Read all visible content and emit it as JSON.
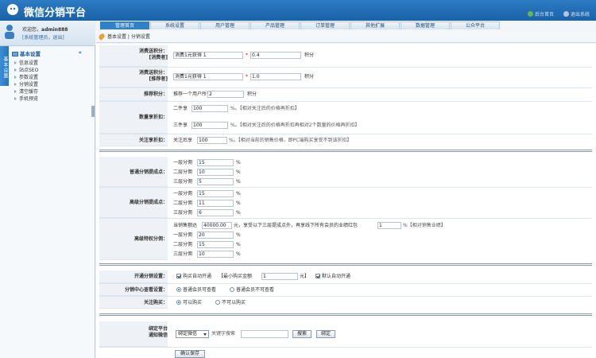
{
  "header": {
    "app_title": "微信分销平台",
    "links": [
      "后台首页",
      "退出系统"
    ]
  },
  "user": {
    "greeting": "欢迎您，",
    "username": "admin888",
    "role": "[系统管理员，退出]"
  },
  "nav": {
    "tabs": [
      "管理首页",
      "系统设置",
      "用户管理",
      "产品管理",
      "订单管理",
      "其他扩展",
      "数据管理",
      "公众平台"
    ],
    "active": "管理首页"
  },
  "breadcrumb": "基本设置 | 分销设置",
  "sidebar": {
    "vertical_tab": "基本设置",
    "section": "基本设置",
    "collapse": "«",
    "items": [
      "信息设置",
      "站点SEO",
      "参数设置",
      "分销设置",
      "清空缓存",
      "手机预览"
    ]
  },
  "form": {
    "consume_buyer": {
      "label1": "消费送积分：",
      "label2": "[消费者]",
      "value": "消费1元获得 1",
      "mult": "0.4",
      "unit": "积分"
    },
    "consume_referrer": {
      "label1": "消费送积分：",
      "label2": "[推荐者]",
      "value": "消费1元获得 1",
      "mult": "1.0",
      "unit": "积分"
    },
    "referral_points": {
      "label": "推荐积分：",
      "prefix": "推荐一个用户所得",
      "value": "2",
      "unit": "积分"
    },
    "qty_discount": {
      "label": "数量享折扣：",
      "r1_prefix": "二件享",
      "r1_value": "100",
      "r1_hint": "%。【相对关注后的价格再折扣】",
      "r2_prefix": "三件享",
      "r2_value": "100",
      "r2_hint": "%。【相对关注后的价格再折扣再相对2个数量的价格再折扣】"
    },
    "follow_discount": {
      "label": "关注享折扣：",
      "prefix": "关注后享",
      "value": "100",
      "hint": "%。【相对当前的销售价格，即PC端购买享受不到该折扣】"
    },
    "normal_points": {
      "label": "普通分销提成点：",
      "rows": [
        {
          "prefix": "一层分佣",
          "value": "15",
          "unit": "%"
        },
        {
          "prefix": "二层分佣",
          "value": "10",
          "unit": "%"
        },
        {
          "prefix": "三层分佣",
          "value": "5",
          "unit": "%"
        }
      ]
    },
    "senior_points": {
      "label": "高级分销提成点：",
      "rows": [
        {
          "prefix": "一层分佣",
          "value": "15",
          "unit": "%"
        },
        {
          "prefix": "二层分佣",
          "value": "11",
          "unit": "%"
        },
        {
          "prefix": "三层分佣",
          "value": "6",
          "unit": "%"
        }
      ]
    },
    "senior_rights": {
      "label": "高级特权分佣：",
      "line_prefix": "当销售额达",
      "amount": "40000.00",
      "line_mid": "元，享受以下三层提成点外，再享线下所有会员的业绩红包",
      "bonus": "1",
      "line_end": "%【相对销售业绩】",
      "rows": [
        {
          "prefix": "一层分佣",
          "value": "20",
          "unit": "%"
        },
        {
          "prefix": "二层分佣",
          "value": "15",
          "unit": "%"
        },
        {
          "prefix": "三层分佣",
          "value": "10",
          "unit": "%"
        }
      ]
    },
    "open_distribution": {
      "label": "开通分销设置：",
      "opt1": "购买自动开通",
      "min_label": "【最小购买金额",
      "min_value": "1",
      "min_unit": "元】",
      "opt2": "默认自动开通"
    },
    "center_view": {
      "label": "分销中心查看设置：",
      "opt1": "普通会员可查看",
      "opt2": "普通会员不可查看"
    },
    "follow_buy": {
      "label": "关注购买：",
      "opt1": "可以购买",
      "opt2": "不可以购买"
    },
    "bind_platform": {
      "label1": "绑定平台",
      "label2": "通知微信",
      "select": "绑定微信",
      "search_placeholder": "关键字搜索",
      "search_btn": "搜索",
      "bind_btn": "绑定"
    },
    "submit": "确认保存"
  }
}
